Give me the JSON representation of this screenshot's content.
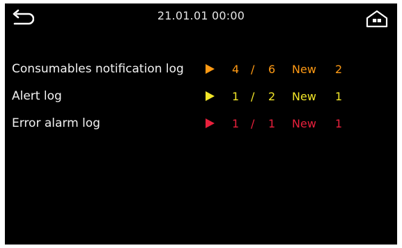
{
  "header": {
    "datetime": "21.01.01 00:00",
    "back_icon": "back-arrow-icon",
    "home_icon": "home-icon"
  },
  "logs": [
    {
      "label": "Consumables notification log",
      "current": "4",
      "separator": "/",
      "total": "6",
      "new_label": "New",
      "new_count": "2",
      "color": "#ff9a14",
      "icon": "play-arrow-icon"
    },
    {
      "label": "Alert log",
      "current": "1",
      "separator": "/",
      "total": "2",
      "new_label": "New",
      "new_count": "1",
      "color": "#f2e628",
      "icon": "play-arrow-icon"
    },
    {
      "label": "Error alarm log",
      "current": "1",
      "separator": "/",
      "total": "1",
      "new_label": "New",
      "new_count": "1",
      "color": "#e8203c",
      "icon": "play-arrow-icon"
    }
  ]
}
